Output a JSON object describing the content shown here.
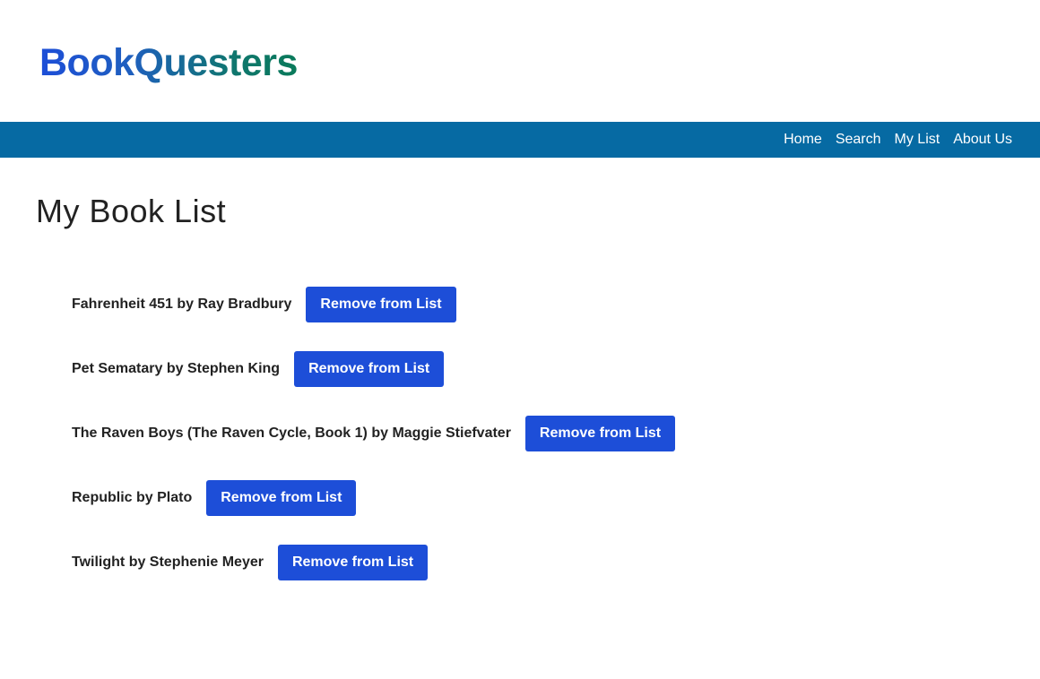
{
  "header": {
    "logo_text": "BookQuesters"
  },
  "nav": {
    "items": [
      {
        "label": "Home"
      },
      {
        "label": "Search"
      },
      {
        "label": "My List"
      },
      {
        "label": "About Us"
      }
    ]
  },
  "main": {
    "title": "My Book List",
    "books": [
      {
        "text": "Fahrenheit 451 by Ray Bradbury",
        "button_label": "Remove from List"
      },
      {
        "text": "Pet Sematary by Stephen King",
        "button_label": "Remove from List"
      },
      {
        "text": "The Raven Boys (The Raven Cycle, Book 1) by Maggie Stiefvater",
        "button_label": "Remove from List"
      },
      {
        "text": "Republic by Plato",
        "button_label": "Remove from List"
      },
      {
        "text": "Twilight by Stephenie Meyer",
        "button_label": "Remove from List"
      }
    ]
  },
  "colors": {
    "navbar": "#066aa3",
    "button": "#1d4ed8",
    "logo_start": "#1d4ed8",
    "logo_end": "#0a7a5a"
  }
}
